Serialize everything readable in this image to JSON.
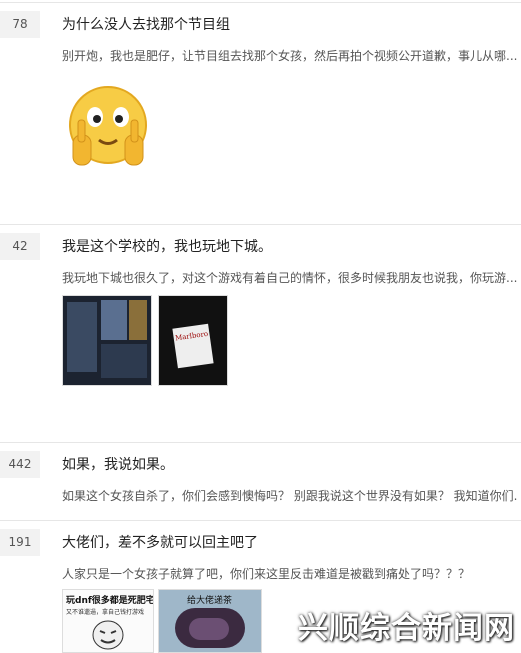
{
  "posts": [
    {
      "count": "78",
      "title": "为什么没人去找那个节目组",
      "body": "别开炮，我也是肥仔，让节目组去找那个女孩，然后再拍个视频公开道歉，事儿从哪..."
    },
    {
      "count": "42",
      "title": "我是这个学校的，我也玩地下城。",
      "body": "我玩地下城也很久了，对这个游戏有着自己的情怀，很多时候我朋友也说我，你玩游..."
    },
    {
      "count": "442",
      "title": "如果，我说如果。",
      "body": "如果这个女孩自杀了，你们会感到懊悔吗？ 别跟我说这个世界没有如果？ 我知道你们..."
    },
    {
      "count": "191",
      "title": "大佬们，差不多就可以回主吧了",
      "body": "人家只是一个女孩子就算了吧，你们来这里反击难道是被戳到痛处了吗？？？"
    }
  ],
  "images": {
    "cig_brand": "Marlboro",
    "meme_left_text": "玩dnf很多都是死肥宅。",
    "meme_left_sub": "又不谁邋遢，拿自己钱打游戏",
    "meme_right_text": "给大佬递茶"
  },
  "watermark": "兴顺综合新闻网"
}
